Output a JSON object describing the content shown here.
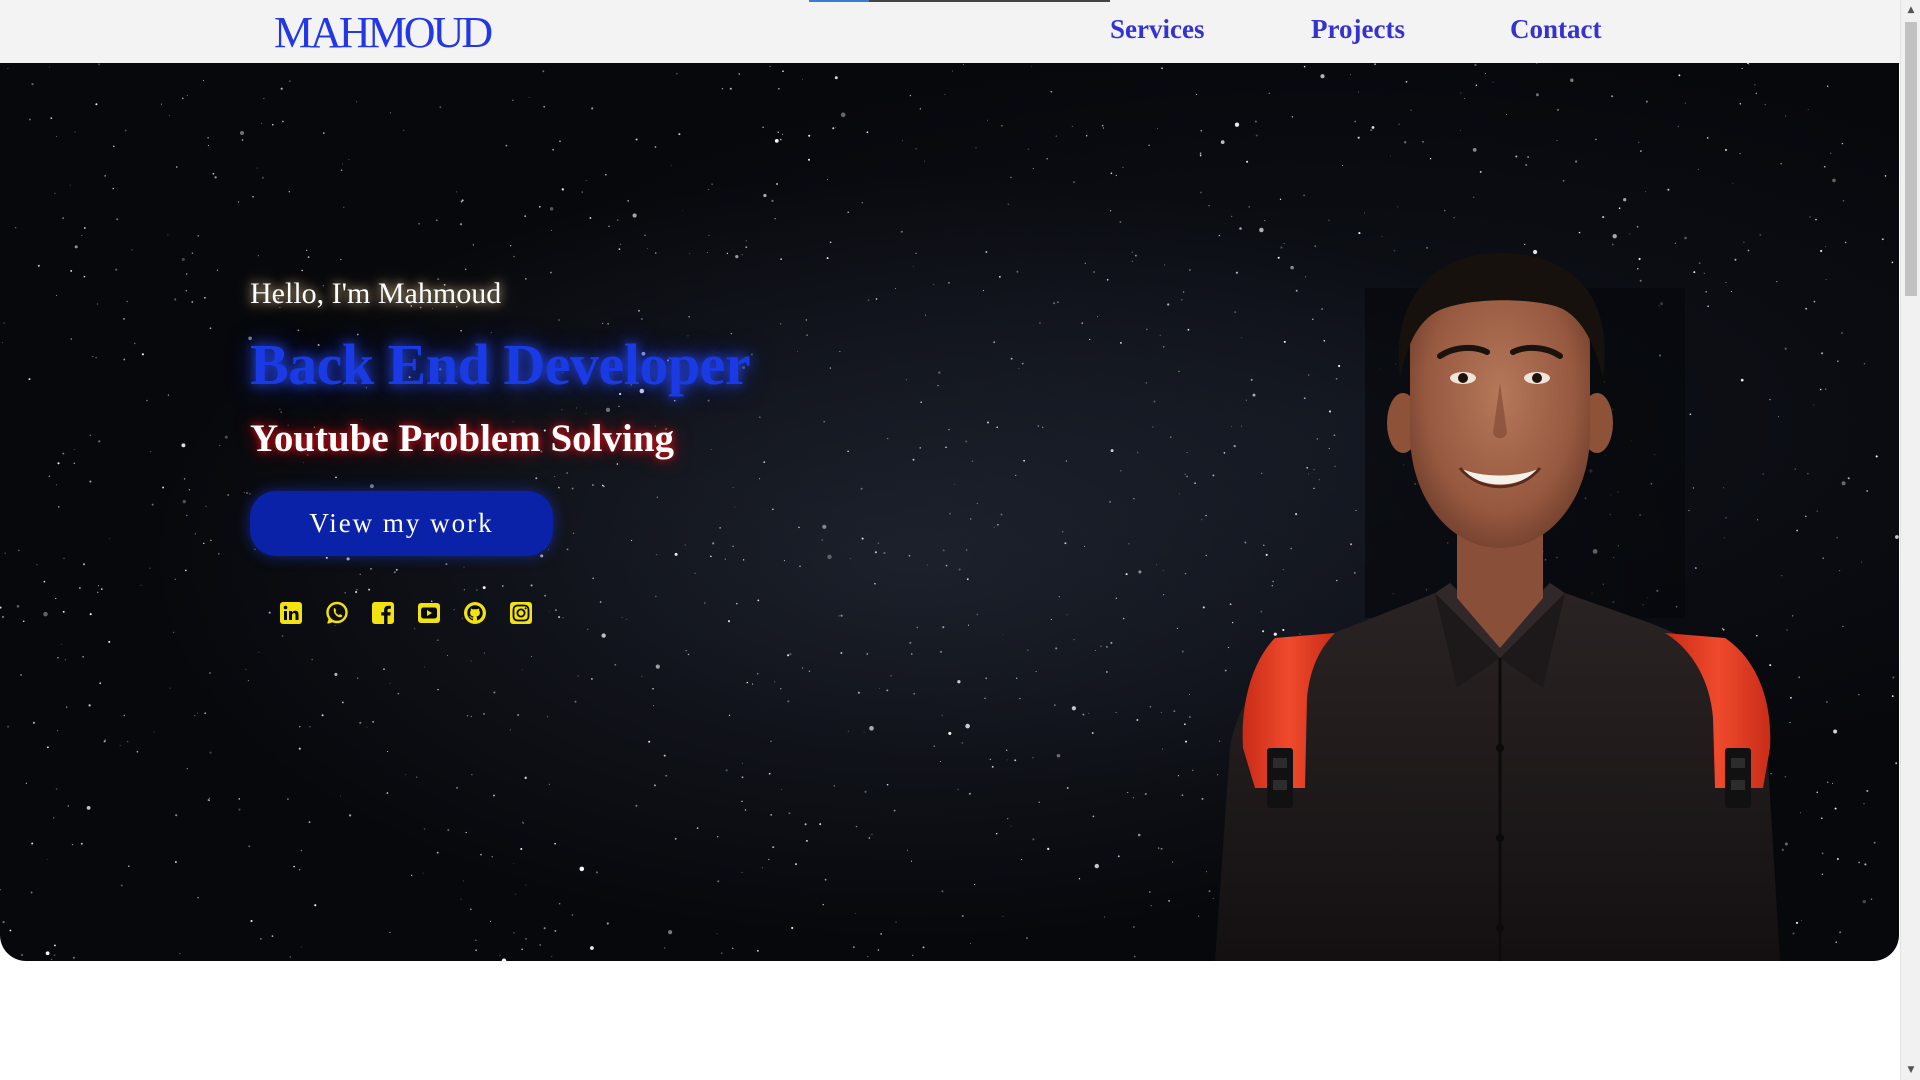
{
  "brand": {
    "logo_text": "MAHMOUD"
  },
  "nav": {
    "scroll_progress_percent": 20,
    "links": [
      {
        "label": "Services"
      },
      {
        "label": "Projects"
      },
      {
        "label": "Contact"
      }
    ]
  },
  "hero": {
    "greeting": "Hello, I'm Mahmoud",
    "role": "Back End Developer",
    "subtitle": "Youtube Problem Solving",
    "cta_label": "View my work",
    "social_icons": [
      "linkedin-icon",
      "whatsapp-icon",
      "facebook-icon",
      "youtube-icon",
      "github-icon",
      "instagram-icon"
    ],
    "portrait_alt": "portrait photo"
  },
  "colors": {
    "logo": "#2238e6",
    "nav_link": "#3533d0",
    "role_text": "#1a3ae6",
    "cta_background": "#0a22a8",
    "social_icon": "#f2e20f",
    "background": "#07080c",
    "shirt": "#1c1718",
    "backpack_straps": "#e33b22"
  }
}
